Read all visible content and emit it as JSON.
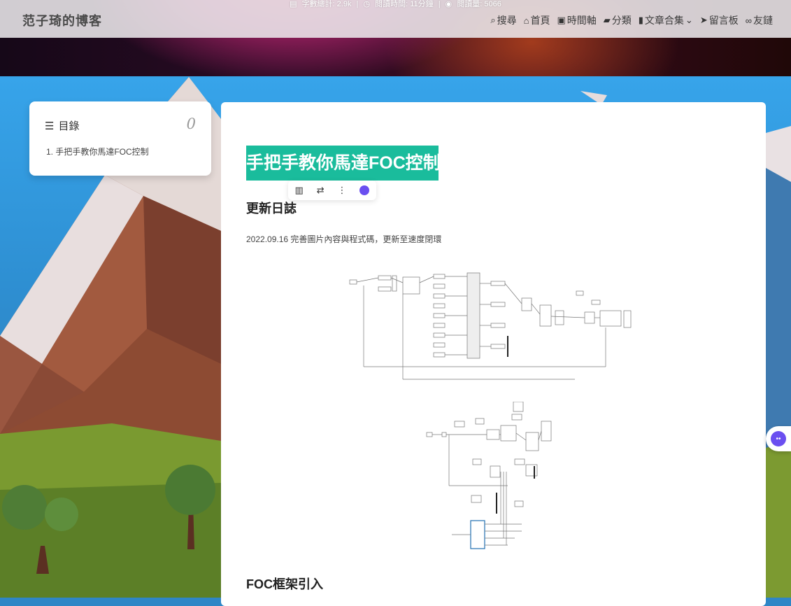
{
  "site": {
    "title": "范子琦的博客",
    "stats": {
      "word_count": "字數總計: 2.9k",
      "sep1": "|",
      "reading_time": "閱讀時間: 11分鐘",
      "sep2": "|",
      "views": "閱讀量: 5066"
    }
  },
  "nav": {
    "items": [
      {
        "label": "搜尋",
        "icon": "search-icon"
      },
      {
        "label": "首頁",
        "icon": "home-icon"
      },
      {
        "label": "時間軸",
        "icon": "archive-icon"
      },
      {
        "label": "分類",
        "icon": "folder-icon"
      },
      {
        "label": "文章合集",
        "icon": "book-icon"
      },
      {
        "label": "留言板",
        "icon": "paper-plane-icon"
      },
      {
        "label": "友鏈",
        "icon": "link-icon"
      }
    ]
  },
  "toc": {
    "heading": "目錄",
    "count": "0",
    "items": [
      "1. 手把手教你馬達FOC控制"
    ]
  },
  "post": {
    "title": "手把手教你馬達FOC控制",
    "section_update": "更新日誌",
    "update_text": "2022.09.16 完善圖片內容與程式碼，更新至速度閉環",
    "section_foc": "FOC框架引入"
  },
  "colors": {
    "title_highlight": "#1abc9c",
    "assistant_accent": "#6b4ff0"
  }
}
